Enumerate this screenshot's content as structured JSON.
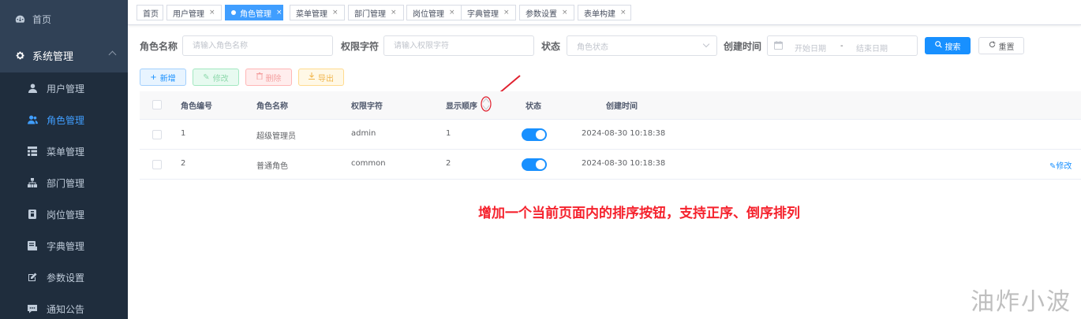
{
  "sidebar": {
    "home": "首页",
    "group": "系统管理",
    "items": [
      {
        "label": "用户管理",
        "icon": "user-icon"
      },
      {
        "label": "角色管理",
        "icon": "peoples-icon",
        "active": true
      },
      {
        "label": "菜单管理",
        "icon": "tree-table-icon"
      },
      {
        "label": "部门管理",
        "icon": "tree-icon"
      },
      {
        "label": "岗位管理",
        "icon": "post-icon"
      },
      {
        "label": "字典管理",
        "icon": "dict-icon"
      },
      {
        "label": "参数设置",
        "icon": "edit-icon"
      },
      {
        "label": "通知公告",
        "icon": "message-icon"
      }
    ]
  },
  "tags": [
    {
      "label": "首页"
    },
    {
      "label": "用户管理"
    },
    {
      "label": "角色管理",
      "active": true
    },
    {
      "label": "菜单管理"
    },
    {
      "label": "部门管理"
    },
    {
      "label": "岗位管理"
    },
    {
      "label": "字典管理"
    },
    {
      "label": "参数设置"
    },
    {
      "label": "表单构建"
    }
  ],
  "search": {
    "role_name_label": "角色名称",
    "role_name_placeholder": "请输入角色名称",
    "role_key_label": "权限字符",
    "role_key_placeholder": "请输入权限字符",
    "status_label": "状态",
    "status_placeholder": "角色状态",
    "created_label": "创建时间",
    "start_placeholder": "开始日期",
    "separator": "-",
    "end_placeholder": "结束日期",
    "search_btn": "搜索",
    "reset_btn": "重置"
  },
  "toolbar": {
    "add": "新增",
    "edit": "修改",
    "delete": "删除",
    "export": "导出"
  },
  "table": {
    "headers": [
      "角色编号",
      "角色名称",
      "权限字符",
      "显示顺序",
      "状态",
      "创建时间"
    ],
    "rows": [
      {
        "id": "1",
        "name": "超级管理员",
        "key": "admin",
        "sort": "1",
        "enabled": true,
        "created": "2024-08-30 10:18:38",
        "action": ""
      },
      {
        "id": "2",
        "name": "普通角色",
        "key": "common",
        "sort": "2",
        "enabled": true,
        "created": "2024-08-30 10:18:38",
        "action": "修改"
      }
    ]
  },
  "annotation": {
    "note": "增加一个当前页面内的排序按钮，支持正序、倒序排列",
    "arrow_color": "#e0202e"
  },
  "watermark": "油炸小波",
  "colors": {
    "sidebar_bg": "#304156",
    "submenu_bg": "#1f2d3d",
    "primary": "#1890ff",
    "active_menu": "#409eff",
    "note_red": "#f5222d"
  }
}
